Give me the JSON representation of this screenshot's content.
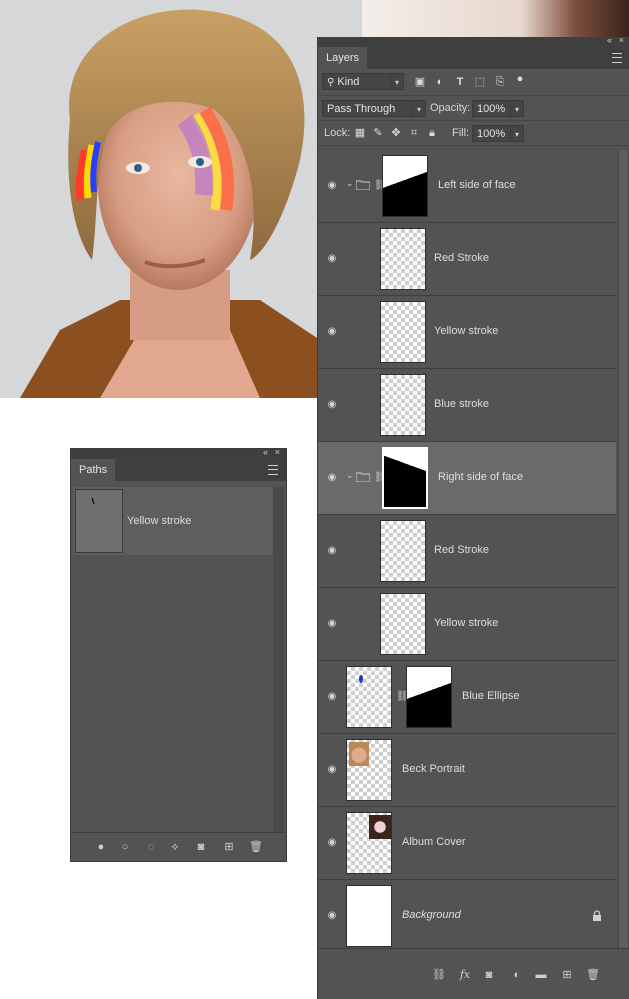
{
  "layers_panel": {
    "tab": "Layers",
    "filter_kind": "Kind",
    "blend_mode": "Pass Through",
    "opacity_label": "Opacity:",
    "opacity_value": "100%",
    "lock_label": "Lock:",
    "fill_label": "Fill:",
    "fill_value": "100%",
    "layers": [
      {
        "name": "Left side of face",
        "type": "group"
      },
      {
        "name": "Red Stroke",
        "type": "layer"
      },
      {
        "name": "Yellow stroke",
        "type": "layer"
      },
      {
        "name": "Blue stroke",
        "type": "layer"
      },
      {
        "name": "Right side of face",
        "type": "group",
        "selected": true
      },
      {
        "name": "Red Stroke",
        "type": "layer"
      },
      {
        "name": "Yellow stroke",
        "type": "layer"
      },
      {
        "name": "Blue Ellipse",
        "type": "masked-layer"
      },
      {
        "name": "Beck Portrait",
        "type": "layer"
      },
      {
        "name": "Album Cover",
        "type": "layer"
      },
      {
        "name": "Background",
        "type": "background",
        "locked": true
      }
    ]
  },
  "paths_panel": {
    "tab": "Paths",
    "items": [
      {
        "name": "Yellow stroke"
      }
    ]
  },
  "icons": {
    "search": "search-icon",
    "eye": "eye-icon",
    "folder": "folder-icon",
    "link": "link-icon",
    "lock": "lock-icon",
    "menu": "panel-menu-icon",
    "trash": "trash-icon"
  },
  "colors": {
    "panel_bg": "#535353",
    "panel_header": "#3f3f3f",
    "selected_row": "#6a6a6a"
  }
}
